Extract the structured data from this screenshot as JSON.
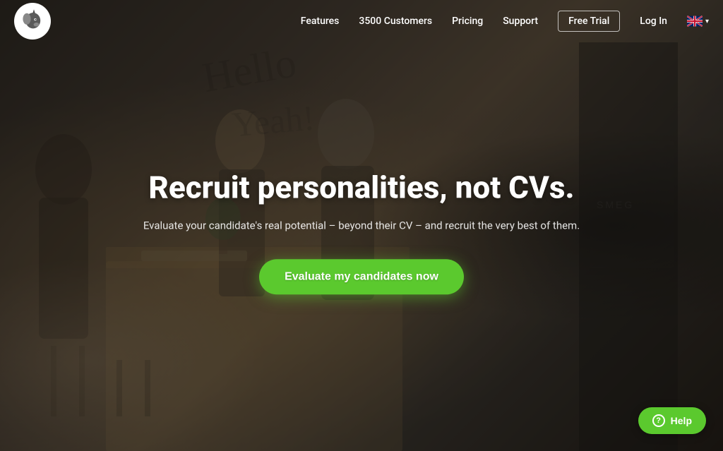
{
  "logo": {
    "alt": "Unicorn logo"
  },
  "nav": {
    "links": [
      {
        "label": "Features",
        "name": "features"
      },
      {
        "label": "3500 Customers",
        "name": "customers"
      },
      {
        "label": "Pricing",
        "name": "pricing"
      },
      {
        "label": "Support",
        "name": "support"
      },
      {
        "label": "Free Trial",
        "name": "free-trial"
      },
      {
        "label": "Log In",
        "name": "login"
      }
    ],
    "lang": {
      "code": "EN",
      "chevron": "▾"
    }
  },
  "hero": {
    "title": "Recruit personalities, not CVs.",
    "subtitle": "Evaluate your candidate's real potential – beyond their CV – and recruit the very best of them.",
    "cta": "Evaluate my candidates now"
  },
  "help": {
    "label": "Help",
    "icon": "?"
  }
}
